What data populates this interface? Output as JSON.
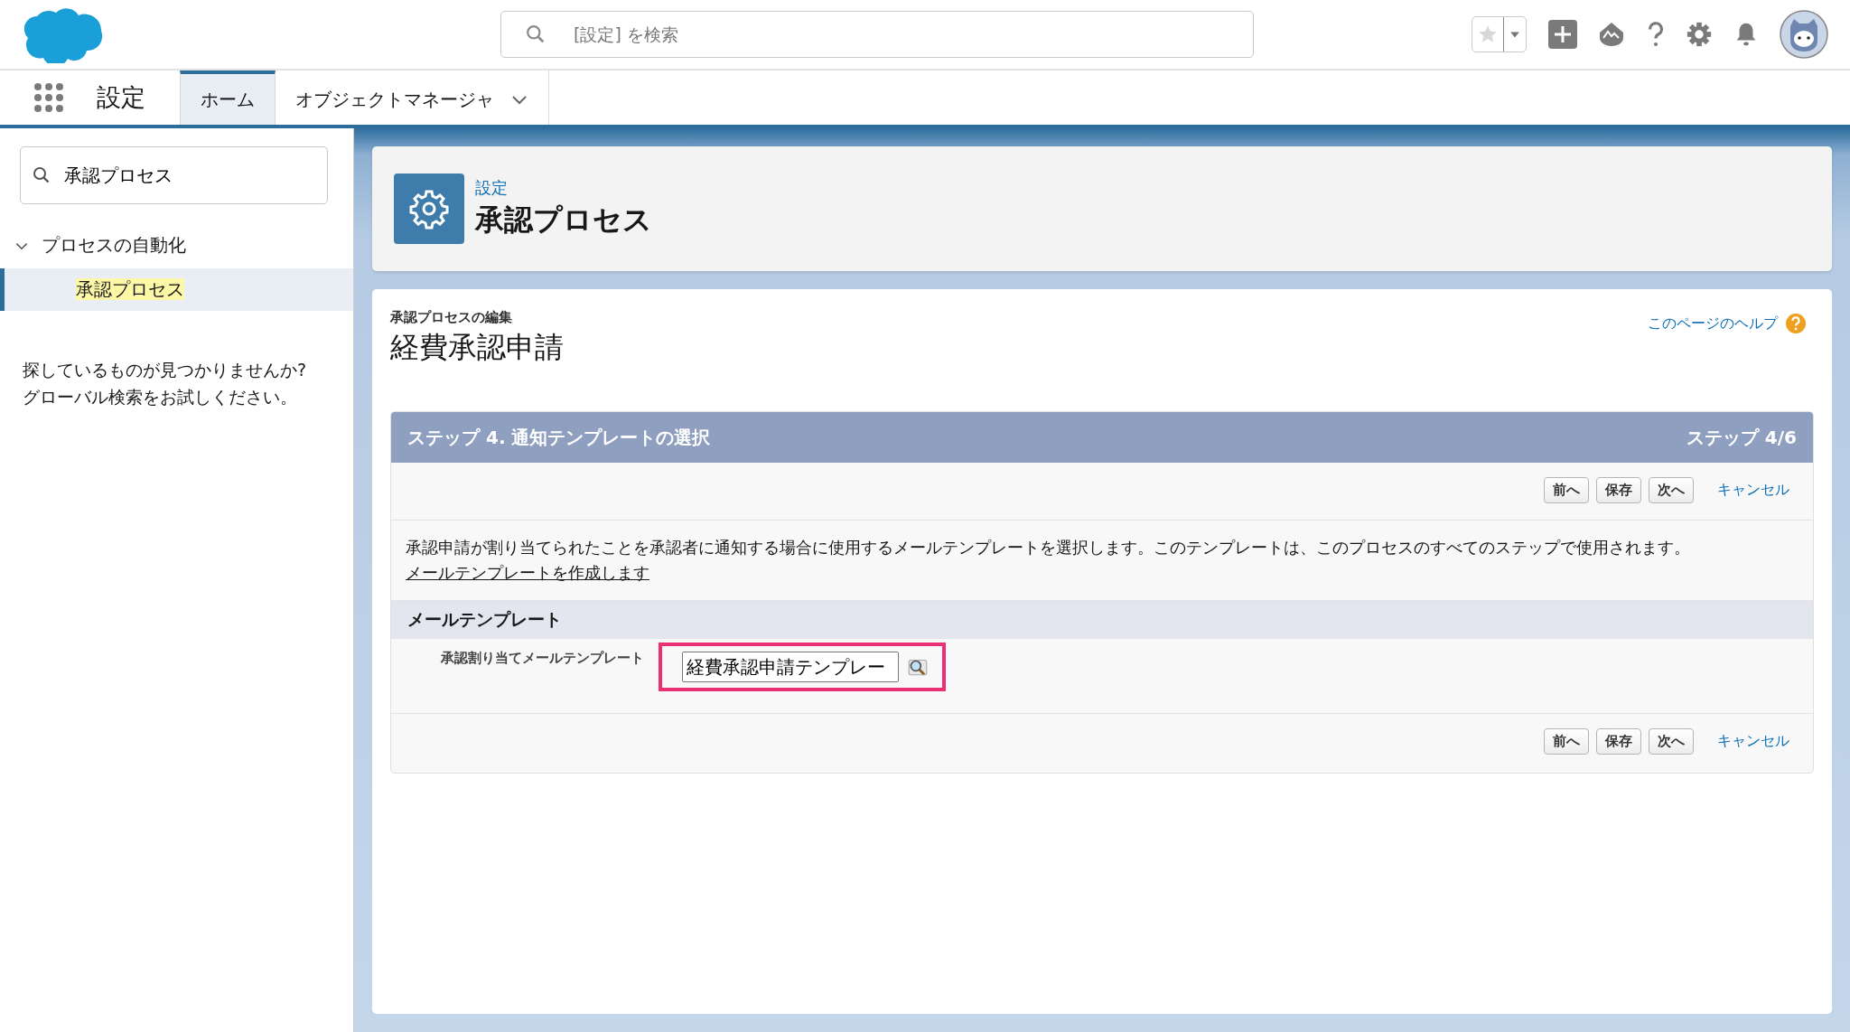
{
  "header": {
    "search": {
      "placeholder": "[設定] を検索"
    }
  },
  "nav": {
    "app_name": "設定",
    "tabs": [
      {
        "label": "ホーム",
        "selected": true,
        "has_menu": false
      },
      {
        "label": "オブジェクトマネージャ",
        "selected": false,
        "has_menu": true
      }
    ]
  },
  "sidebar": {
    "search": {
      "value": "承認プロセス"
    },
    "tree": [
      {
        "label": "プロセスの自動化",
        "expanded": true,
        "children": [
          {
            "label": "承認プロセス",
            "selected": true
          }
        ]
      }
    ],
    "help_lines": [
      "探しているものが見つかりませんか?",
      "グローバル検索をお試しください。"
    ]
  },
  "page_header": {
    "breadcrumb": "設定",
    "title": "承認プロセス"
  },
  "content": {
    "subtitle": "承認プロセスの編集",
    "title": "経費承認申請",
    "help_link": "このページのヘルプ",
    "step": {
      "title": "ステップ 4. 通知テンプレートの選択",
      "counter": "ステップ 4/6"
    },
    "buttons_top": [
      {
        "label": "前へ",
        "kind": "button"
      },
      {
        "label": "保存",
        "kind": "button"
      },
      {
        "label": "次へ",
        "kind": "button"
      },
      {
        "label": "キャンセル",
        "kind": "link"
      }
    ],
    "description": "承認申請が割り当てられたことを承認者に通知する場合に使用するメールテンプレートを選択します。このテンプレートは、このプロセスのすべてのステップで使用されます。",
    "create_link": "メールテンプレートを作成します",
    "section": {
      "title": "メールテンプレート",
      "field": {
        "label": "承認割り当てメールテンプレート",
        "value": "経費承認申請テンプレー",
        "highlighted": true
      }
    },
    "buttons_bottom": [
      {
        "label": "前へ",
        "kind": "button"
      },
      {
        "label": "保存",
        "kind": "button"
      },
      {
        "label": "次へ",
        "kind": "button"
      },
      {
        "label": "キャンセル",
        "kind": "link"
      }
    ]
  }
}
